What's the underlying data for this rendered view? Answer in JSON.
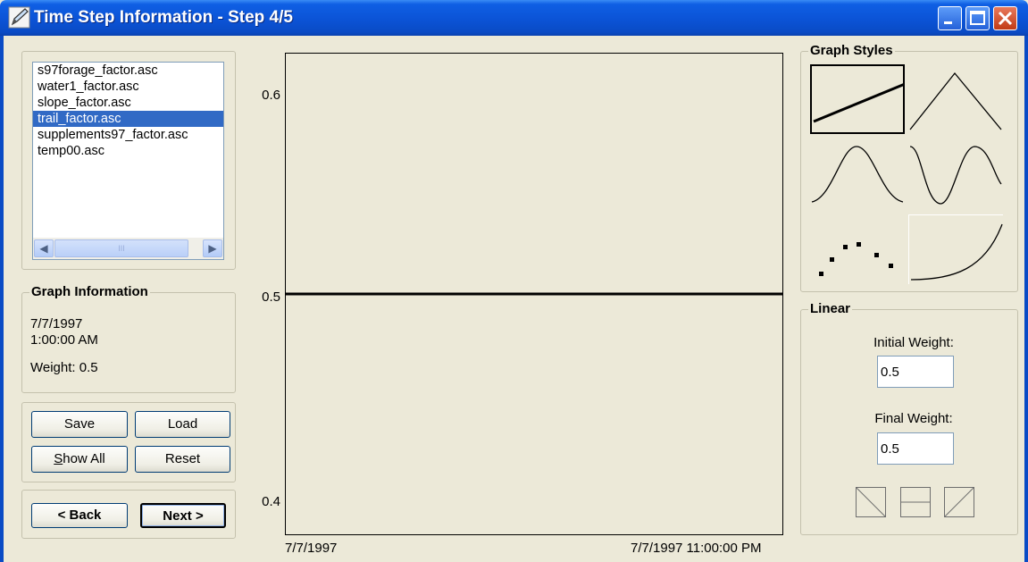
{
  "window": {
    "title": "Time Step Information - Step 4/5",
    "icon": "pen-icon"
  },
  "file_list": {
    "items": [
      "s97forage_factor.asc",
      "water1_factor.asc",
      "slope_factor.asc",
      "trail_factor.asc",
      "supplements97_factor.asc",
      "temp00.asc"
    ],
    "selected_index": 3,
    "scroll_left_icon": "arrow-left-icon",
    "scroll_right_icon": "arrow-right-icon",
    "scroll_grip": "III"
  },
  "graph_info": {
    "title": "Graph Information",
    "date": "7/7/1997",
    "time": "1:00:00 AM",
    "weight": "Weight: 0.5"
  },
  "actions": {
    "save": "Save",
    "load": "Load",
    "show_all": "Show All",
    "show_all_access_key": "S",
    "show_all_rest": "how All",
    "reset": "Reset"
  },
  "nav": {
    "back": "< Back",
    "next": "Next >"
  },
  "chart_data": {
    "type": "line",
    "x": [
      "7/7/1997",
      "7/7/1997 11:00:00 PM"
    ],
    "series": [
      {
        "values": [
          0.5,
          0.5
        ]
      }
    ],
    "y_ticks": [
      "0.6",
      "0.5",
      "0.4"
    ],
    "ylim": [
      0.4,
      0.6
    ],
    "x_tick_labels": [
      "7/7/1997",
      "7/7/1997 11:00:00 PM"
    ],
    "grid": false
  },
  "graph_styles": {
    "title": "Graph Styles",
    "styles": [
      "linear",
      "peak",
      "bell",
      "wave",
      "scatter",
      "exponential"
    ],
    "selected": "linear"
  },
  "linear": {
    "title": "Linear",
    "initial_label": "Initial Weight:",
    "initial_value": "0.5",
    "final_label": "Final Weight:",
    "final_value": "0.5",
    "shape_buttons": [
      "decreasing-line-icon",
      "flat-line-icon",
      "increasing-line-icon"
    ]
  },
  "colors": {
    "titlebar": "#0b53d6",
    "background": "#ece9d8",
    "selection": "#316ac5",
    "close_button": "#c23b16"
  }
}
